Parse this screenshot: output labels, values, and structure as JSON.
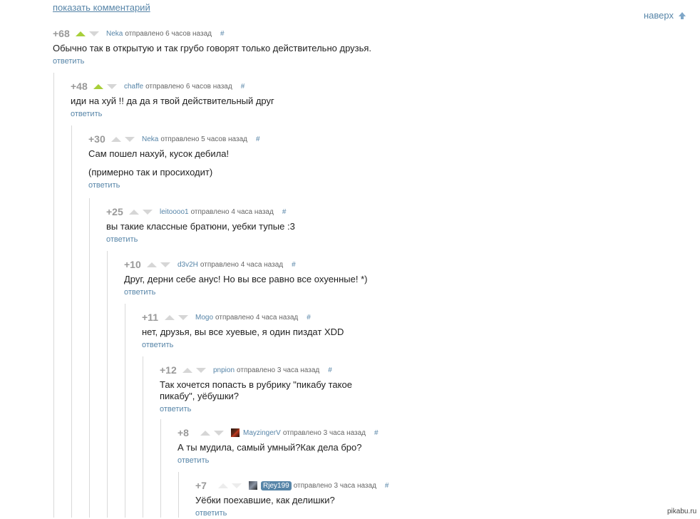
{
  "header": {
    "show_comment": "показать комментарий",
    "to_top": "наверх"
  },
  "comments": [
    {
      "rating": "+68",
      "author": "Neka",
      "time": "отправлено 6 часов назад",
      "hash": "#",
      "text": [
        "Обычно так в открытую и так грубо говорят только действительно друзья."
      ],
      "reply": "ответить"
    },
    {
      "rating": "+48",
      "author": "chaffe",
      "time": "отправлено 6 часов назад",
      "hash": "#",
      "text": [
        "иди на хуй !! да да я твой действительный друг"
      ],
      "reply": "ответить"
    },
    {
      "rating": "+30",
      "author": "Neka",
      "time": "отправлено 5 часов назад",
      "hash": "#",
      "text": [
        "Сам пошел нахуй, кусок дебила!",
        "(примерно так и просиходит)"
      ],
      "reply": "ответить"
    },
    {
      "rating": "+25",
      "author": "leitoooo1",
      "time": "отправлено 4 часа назад",
      "hash": "#",
      "text": [
        "вы такие классные братюни, уебки тупые :3"
      ],
      "reply": "ответить"
    },
    {
      "rating": "+10",
      "author": "d3v2H",
      "time": "отправлено 4 часа назад",
      "hash": "#",
      "text": [
        "Друг, дерни себе анус! Но вы все равно все охуенные! *)"
      ],
      "reply": "ответить"
    },
    {
      "rating": "+11",
      "author": "Mogo",
      "time": "отправлено 4 часа назад",
      "hash": "#",
      "text": [
        "нет, друзья, вы все хуевые, я один пиздат XDD"
      ],
      "reply": "ответить"
    },
    {
      "rating": "+12",
      "author": "pnpion",
      "time": "отправлено 3 часа назад",
      "hash": "#",
      "text": [
        "Так хочется попасть в рубрику \"пикабу такое пикабу\", уёбушки?"
      ],
      "reply": "ответить"
    },
    {
      "rating": "+8",
      "author": "MayzingerV",
      "time": "отправлено 3 часа назад",
      "hash": "#",
      "text": [
        "А ты мудила, самый умный?Как дела бро?"
      ],
      "reply": "ответить"
    },
    {
      "rating": "+7",
      "author": "Rjey199",
      "time": "отправлено 3 часа назад",
      "hash": "#",
      "text": [
        "Уёбки поехавшие, как делишки?"
      ],
      "reply": "ответить"
    }
  ],
  "watermark": "pikabu.ru",
  "colors": {
    "link": "#5785a8",
    "upvote_active": "#a8cf3a",
    "vote_inactive": "#d6d6d6",
    "thread_line": "#d9d9d9"
  }
}
